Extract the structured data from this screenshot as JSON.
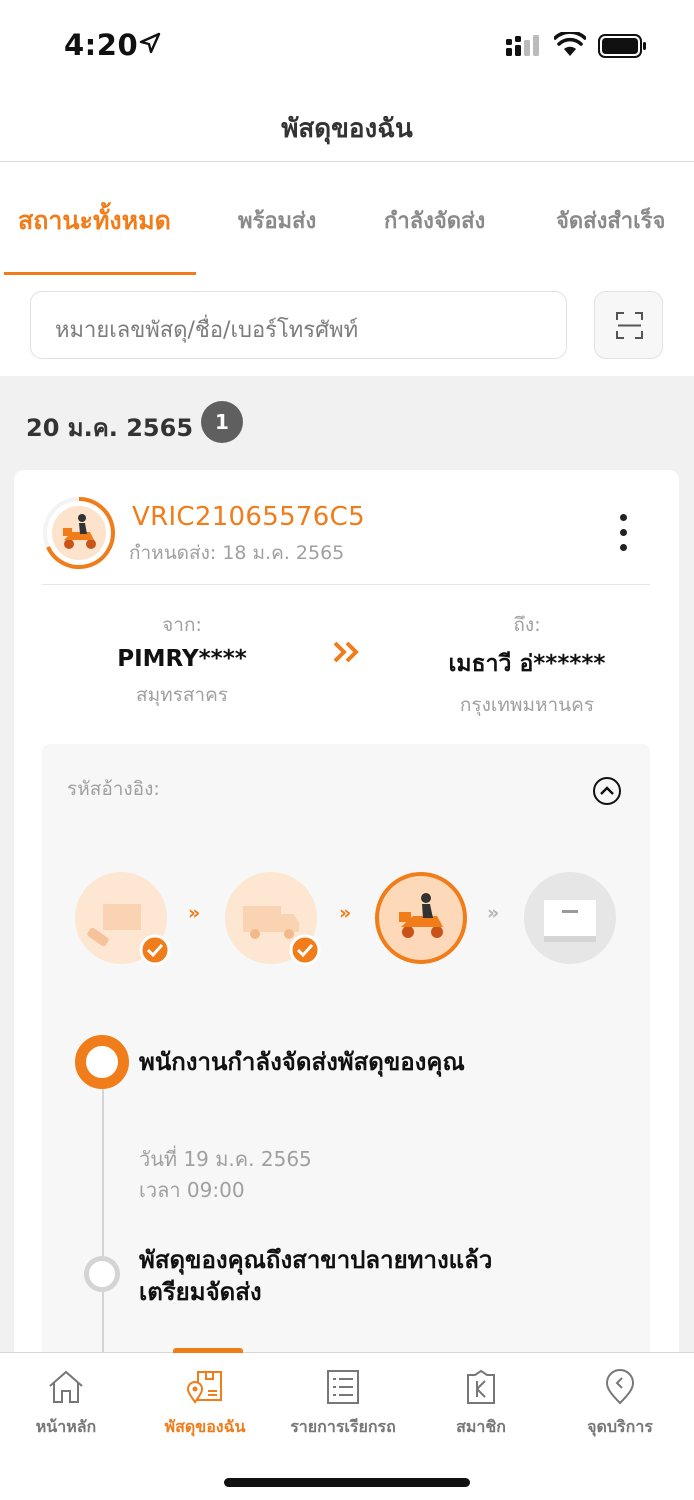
{
  "status_bar": {
    "time": "4:20"
  },
  "header": {
    "title": "พัสดุของฉัน"
  },
  "tabs": [
    {
      "label": "สถานะทั้งหมด",
      "active": true
    },
    {
      "label": "พร้อมส่ง",
      "active": false
    },
    {
      "label": "กำลังจัดส่ง",
      "active": false
    },
    {
      "label": "จัดส่งสำเร็จ",
      "active": false
    }
  ],
  "search": {
    "placeholder": "หมายเลขพัสดุ/ชื่อ/เบอร์โทรศัพท์"
  },
  "group": {
    "date": "20 ม.ค. 2565",
    "count": "1"
  },
  "parcel": {
    "tracking_number": "VRIC21065576C5",
    "due_date": "กำหนดส่ง: 18 ม.ค. 2565",
    "from_label": "จาก:",
    "from_name": "PIMRY****",
    "from_city": "สมุทรสาคร",
    "to_label": "ถึง:",
    "to_name": "เมธาวี อ่******",
    "to_city": "กรุงเทพมหานคร",
    "reference_label": "รหัสอ้างอิง:"
  },
  "timeline": [
    {
      "title": "พนักงานกำลังจัดส่งพัสดุของคุณ",
      "date": "วันที่ 19 ม.ค. 2565",
      "time": "เวลา 09:00"
    },
    {
      "title_line1": "พัสดุของคุณถึงสาขาปลายทางแล้ว",
      "title_line2": "เตรียมจัดส่ง"
    }
  ],
  "bottom_nav": [
    {
      "label": "หน้าหลัก",
      "icon": "home-icon"
    },
    {
      "label": "พัสดุของฉัน",
      "icon": "parcel-icon",
      "active": true
    },
    {
      "label": "รายการเรียกรถ",
      "icon": "list-icon"
    },
    {
      "label": "สมาชิก",
      "icon": "member-icon"
    },
    {
      "label": "จุดบริการ",
      "icon": "location-icon"
    }
  ],
  "colors": {
    "accent": "#f07c1a",
    "background": "#f1f1f1"
  }
}
